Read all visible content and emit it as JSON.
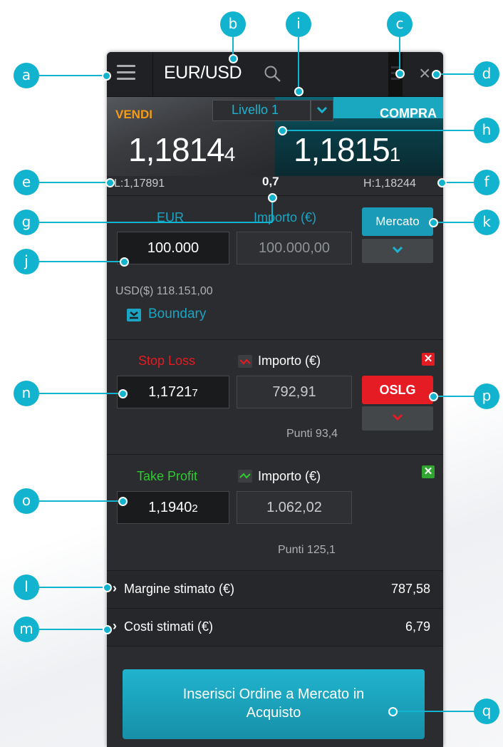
{
  "header": {
    "pair": "EUR/USD"
  },
  "prices": {
    "sell_label": "VENDI",
    "buy_label": "COMPRA",
    "level": "Livello 1",
    "sell_main": "1,1814",
    "sell_small": "4",
    "buy_main": "1,1815",
    "buy_small": "1",
    "low": "L:1,17891",
    "high": "H:1,18244",
    "spread": "0,7"
  },
  "order": {
    "qty_label": "EUR",
    "amount_label": "Importo (€)",
    "qty_value": "100.000",
    "amount_value": "100.000,00",
    "order_type": "Mercato",
    "usd_value": "USD($) 118.151,00",
    "boundary": "Boundary"
  },
  "stop_loss": {
    "label": "Stop Loss",
    "amount_label": "Importo (€)",
    "price_main": "1,1721",
    "price_small": "7",
    "amount": "792,91",
    "oslg": "OSLG",
    "punti": "Punti 93,4"
  },
  "take_profit": {
    "label": "Take Profit",
    "amount_label": "Importo (€)",
    "price_main": "1,1940",
    "price_small": "2",
    "amount": "1.062,02",
    "punti": "Punti 125,1"
  },
  "estimates": {
    "margin_label": "Margine stimato (€)",
    "margin_value": "787,58",
    "costs_label": "Costi stimati (€)",
    "costs_value": "6,79"
  },
  "cta": {
    "line1": "Inserisci Ordine a Mercato in",
    "line2": "Acquisto"
  },
  "callouts": {
    "a": "a",
    "b": "b",
    "c": "c",
    "d": "d",
    "e": "e",
    "f": "f",
    "g": "g",
    "h": "h",
    "i": "i",
    "j": "j",
    "k": "k",
    "l": "l",
    "m": "m",
    "n": "n",
    "o": "o",
    "p": "p",
    "q": "q"
  },
  "colors": {
    "accent": "#12b3cf",
    "sell": "#f49c17",
    "stop": "#e31b23",
    "profit": "#2fcb2f"
  }
}
